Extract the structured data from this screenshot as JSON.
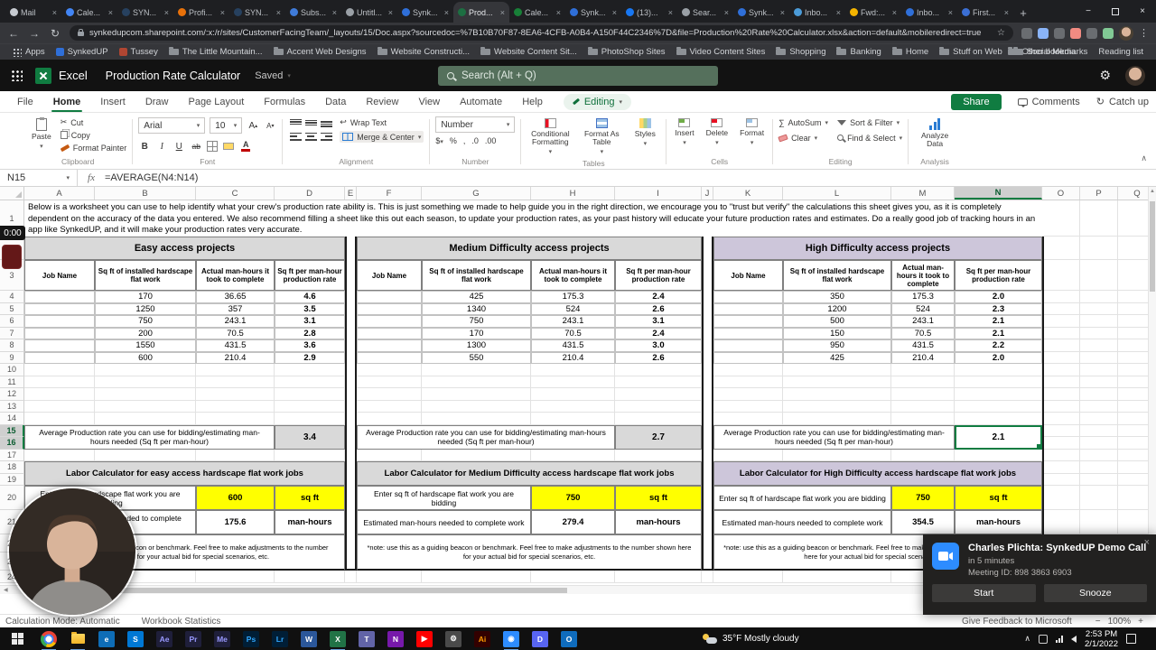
{
  "icons": {
    "chevron_down": "▾",
    "chevron_up": "∧",
    "close": "×",
    "plus": "+",
    "back": "←",
    "forward": "→",
    "refresh": "↻",
    "star": "☆",
    "menu_dots": "⋮",
    "sigma": "∑",
    "wrap_arrow": "↩",
    "gear": "⚙",
    "minus": "−",
    "scissors": "✂"
  },
  "browser": {
    "tabs": [
      {
        "title": "Mail",
        "color": "#c7cbd1"
      },
      {
        "title": "Cale...",
        "color": "#4285f4"
      },
      {
        "title": "SYN...",
        "color": "#27415f"
      },
      {
        "title": "Profi...",
        "color": "#e8710a"
      },
      {
        "title": "SYN...",
        "color": "#27415f"
      },
      {
        "title": "Subs...",
        "color": "#3f7bd9"
      },
      {
        "title": "Untitl...",
        "color": "#9aa0a6"
      },
      {
        "title": "Synk...",
        "color": "#2f6fd8"
      },
      {
        "title": "Prod...",
        "color": "#1d6f42"
      },
      {
        "title": "Cale...",
        "color": "#188038"
      },
      {
        "title": "Synk...",
        "color": "#2f6fd8"
      },
      {
        "title": "(13)...",
        "color": "#1877f2"
      },
      {
        "title": "Sear...",
        "color": "#9aa0a6"
      },
      {
        "title": "Synk...",
        "color": "#2f6fd8"
      },
      {
        "title": "Inbo...",
        "color": "#4b9bd8"
      },
      {
        "title": "Fwd:...",
        "color": "#f4b400"
      },
      {
        "title": "Inbo...",
        "color": "#2f6fd8"
      },
      {
        "title": "First...",
        "color": "#3b6fd4"
      }
    ],
    "active_tab": 8,
    "url": "synkedupcom.sharepoint.com/:x:/r/sites/CustomerFacingTeam/_layouts/15/Doc.aspx?sourcedoc=%7B10B70F87-8EA6-4CFB-A0B4-A150F44C2346%7D&file=Production%20Rate%20Calculator.xlsx&action=default&mobileredirect=true",
    "bookmarks": [
      {
        "label": "Apps",
        "type": "apps"
      },
      {
        "label": "SynkedUP",
        "type": "site",
        "color": "#2f6fd8"
      },
      {
        "label": "Tussey",
        "type": "site",
        "color": "#b04632"
      },
      {
        "label": "The Little Mountain...",
        "type": "folder"
      },
      {
        "label": "Accent Web Designs",
        "type": "folder"
      },
      {
        "label": "Website Constructi...",
        "type": "folder"
      },
      {
        "label": "Website Content Sit...",
        "type": "folder"
      },
      {
        "label": "PhotoShop Sites",
        "type": "folder"
      },
      {
        "label": "Video Content Sites",
        "type": "folder"
      },
      {
        "label": "Shopping",
        "type": "folder"
      },
      {
        "label": "Banking",
        "type": "folder"
      },
      {
        "label": "Home",
        "type": "folder"
      },
      {
        "label": "Stuff on Web",
        "type": "folder"
      },
      {
        "label": "Social Media",
        "type": "folder"
      }
    ],
    "bookmarks_right": [
      "Other bookmarks",
      "Reading list"
    ]
  },
  "excel": {
    "app_name": "Excel",
    "doc_title": "Production Rate Calculator",
    "saved_status": "Saved",
    "search_placeholder": "Search (Alt + Q)",
    "ribbon_tabs": [
      "File",
      "Home",
      "Insert",
      "Draw",
      "Page Layout",
      "Formulas",
      "Data",
      "Review",
      "View",
      "Automate",
      "Help"
    ],
    "active_tab": "Home",
    "editing_label": "Editing",
    "share_label": "Share",
    "comments_label": "Comments",
    "catchup_label": "Catch up",
    "group_labels": [
      "Clipboard",
      "Font",
      "Alignment",
      "Number",
      "Tables",
      "Cells",
      "Editing",
      "Analysis"
    ],
    "toolbar": {
      "paste": "Paste",
      "cut": "Cut",
      "copy": "Copy",
      "format_painter": "Format Painter",
      "font_name": "Arial",
      "font_size": "10",
      "wrap_text": "Wrap Text",
      "merge_center": "Merge & Center",
      "number_format": "Number",
      "currency": "$",
      "percent": "%",
      "comma": ",",
      "dec_inc": ".0",
      "dec_dec": ".00",
      "conditional_formatting": "Conditional Formatting",
      "format_as_table": "Format As Table",
      "styles": "Styles",
      "insert": "Insert",
      "delete": "Delete",
      "format": "Format",
      "autosum": "AutoSum",
      "clear": "Clear",
      "sort_filter": "Sort & Filter",
      "find_select": "Find & Select",
      "analyze_data": "Analyze Data"
    },
    "name_box": "N15",
    "formula": "=AVERAGE(N4:N14)"
  },
  "sheet": {
    "columns": [
      "A",
      "B",
      "C",
      "D",
      "E",
      "F",
      "G",
      "H",
      "I",
      "J",
      "K",
      "L",
      "M",
      "N",
      "O",
      "P",
      "Q"
    ],
    "selected_column": "N",
    "selected_rows": [
      15,
      16
    ],
    "intro_text": "Below is a worksheet you can use to help identify what your crew's production rate ability is. This is just something we made to help guide you in the right direction, we encourage you to \"trust but verify\" the calculations this sheet gives you, as it is completely dependent on the accuracy of the data you entered. We also recommend filling a sheet like this out each season, to update your production rates, as your past history will educate your future production rates and estimates. Do a really good job of tracking hours in an app like SynkedUP, and it will make your production rates very accurate.",
    "sections": [
      {
        "title": "Easy access projects",
        "col_headers": [
          "Job Name",
          "Sq ft of installed hardscape flat work",
          "Actual man-hours it took to complete",
          "Sq ft per man-hour production rate"
        ],
        "rows": [
          [
            "",
            "170",
            "36.65",
            "4.6"
          ],
          [
            "",
            "1250",
            "357",
            "3.5"
          ],
          [
            "",
            "750",
            "243.1",
            "3.1"
          ],
          [
            "",
            "200",
            "70.5",
            "2.8"
          ],
          [
            "",
            "1550",
            "431.5",
            "3.6"
          ],
          [
            "",
            "600",
            "210.4",
            "2.9"
          ]
        ],
        "avg_label": "Average Production rate you can use for bidding/estimating man-hours needed (Sq ft per man-hour)",
        "avg_value": "3.4",
        "calc_title": "Labor Calculator for easy access hardscape flat work jobs",
        "enter_label": "Enter sq ft of hardscape flat work you are bidding",
        "enter_value": "600",
        "enter_unit": "sq ft",
        "est_label": "Estimated man-hours needed to complete work",
        "est_value": "175.6",
        "est_unit": "man-hours",
        "note": "*note: use this as a guiding beacon or benchmark. Feel free to make adjustments to the number shown here for your actual bid for special scenarios, etc."
      },
      {
        "title": "Medium Difficulty access projects",
        "col_headers": [
          "Job Name",
          "Sq ft of installed hardscape flat work",
          "Actual man-hours it took to complete",
          "Sq ft per man-hour production rate"
        ],
        "rows": [
          [
            "",
            "425",
            "175.3",
            "2.4"
          ],
          [
            "",
            "1340",
            "524",
            "2.6"
          ],
          [
            "",
            "750",
            "243.1",
            "3.1"
          ],
          [
            "",
            "170",
            "70.5",
            "2.4"
          ],
          [
            "",
            "1300",
            "431.5",
            "3.0"
          ],
          [
            "",
            "550",
            "210.4",
            "2.6"
          ]
        ],
        "avg_label": "Average Production rate you can use for bidding/estimating man-hours needed (Sq ft per man-hour)",
        "avg_value": "2.7",
        "calc_title": "Labor Calculator for Medium Difficulty access hardscape flat work jobs",
        "enter_label": "Enter sq ft of hardscape flat work you are bidding",
        "enter_value": "750",
        "enter_unit": "sq ft",
        "est_label": "Estimated man-hours needed to complete work",
        "est_value": "279.4",
        "est_unit": "man-hours",
        "note": "*note: use this as a guiding beacon or benchmark. Feel free to make adjustments to the number shown here for your actual bid for special scenarios, etc."
      },
      {
        "title": "High Difficulty access projects",
        "col_headers": [
          "Job Name",
          "Sq ft of installed hardscape flat work",
          "Actual man-hours it took to complete",
          "Sq ft per man-hour production rate"
        ],
        "rows": [
          [
            "",
            "350",
            "175.3",
            "2.0"
          ],
          [
            "",
            "1200",
            "524",
            "2.3"
          ],
          [
            "",
            "500",
            "243.1",
            "2.1"
          ],
          [
            "",
            "150",
            "70.5",
            "2.1"
          ],
          [
            "",
            "950",
            "431.5",
            "2.2"
          ],
          [
            "",
            "425",
            "210.4",
            "2.0"
          ]
        ],
        "avg_label": "Average Production rate you can use for bidding/estimating man-hours needed (Sq ft per man-hour)",
        "avg_value": "2.1",
        "calc_title": "Labor Calculator for High Difficulty access hardscape flat work jobs",
        "enter_label": "Enter sq ft of hardscape flat work you are bidding",
        "enter_value": "750",
        "enter_unit": "sq ft",
        "est_label": "Estimated man-hours needed to complete work",
        "est_value": "354.5",
        "est_unit": "man-hours",
        "note": "*note: use this as a guiding beacon or benchmark. Feel free to make adjustments to the number shown here for your actual bid for special scenarios, etc."
      }
    ]
  },
  "status_bar": {
    "calc_mode": "Calculation Mode: Automatic",
    "workbook_stats": "Workbook Statistics",
    "feedback": "Give Feedback to Microsoft",
    "zoom": "100%"
  },
  "overlays": {
    "rec_time": "0:00",
    "meeting": {
      "title": "Charles Plichta: SynkedUP Demo Call",
      "subtitle": "in 5 minutes",
      "meeting_id": "Meeting ID: 898 3863 6903",
      "start_label": "Start",
      "snooze_label": "Snooze"
    }
  },
  "taskbar": {
    "weather": "35°F Mostly cloudy",
    "clock_time": "2:53 PM",
    "clock_date": "2/1/2022",
    "icons": [
      {
        "name": "chrome",
        "bg": "",
        "fg": "",
        "glyph": "",
        "open": true
      },
      {
        "name": "file-explorer",
        "bg": "",
        "fg": "",
        "glyph": "",
        "open": true
      },
      {
        "name": "edge",
        "bg": "#0e6db6",
        "fg": "#ffffff",
        "glyph": "e",
        "open": false
      },
      {
        "name": "skype",
        "bg": "#0078d4",
        "fg": "#ffffff",
        "glyph": "S",
        "open": false
      },
      {
        "name": "after-effects",
        "bg": "#1f1f3a",
        "fg": "#9999ff",
        "glyph": "Ae",
        "open": false
      },
      {
        "name": "premiere",
        "bg": "#1f1f3a",
        "fg": "#9999ff",
        "glyph": "Pr",
        "open": false
      },
      {
        "name": "media-encoder",
        "bg": "#1f1f3a",
        "fg": "#9999ff",
        "glyph": "Me",
        "open": false
      },
      {
        "name": "photoshop",
        "bg": "#001e36",
        "fg": "#31a8ff",
        "glyph": "Ps",
        "open": false
      },
      {
        "name": "lightroom",
        "bg": "#001e36",
        "fg": "#31a8ff",
        "glyph": "Lr",
        "open": false
      },
      {
        "name": "word",
        "bg": "#2b579a",
        "fg": "#ffffff",
        "glyph": "W",
        "open": false
      },
      {
        "name": "excel",
        "bg": "#217346",
        "fg": "#ffffff",
        "glyph": "X",
        "open": true
      },
      {
        "name": "teams",
        "bg": "#6264a7",
        "fg": "#ffffff",
        "glyph": "T",
        "open": false
      },
      {
        "name": "onenote",
        "bg": "#7719aa",
        "fg": "#ffffff",
        "glyph": "N",
        "open": false
      },
      {
        "name": "youtube",
        "bg": "#ff0000",
        "fg": "#ffffff",
        "glyph": "▶",
        "open": false
      },
      {
        "name": "settings",
        "bg": "#4a4a4a",
        "fg": "#ffffff",
        "glyph": "⚙",
        "open": false
      },
      {
        "name": "illustrator",
        "bg": "#330000",
        "fg": "#ff9a00",
        "glyph": "Ai",
        "open": false
      },
      {
        "name": "zoom",
        "bg": "#2d8cff",
        "fg": "#ffffff",
        "glyph": "◉",
        "open": true
      },
      {
        "name": "discord",
        "bg": "#5865f2",
        "fg": "#ffffff",
        "glyph": "D",
        "open": false
      },
      {
        "name": "outlook",
        "bg": "#0f6cbd",
        "fg": "#ffffff",
        "glyph": "O",
        "open": false
      }
    ]
  }
}
